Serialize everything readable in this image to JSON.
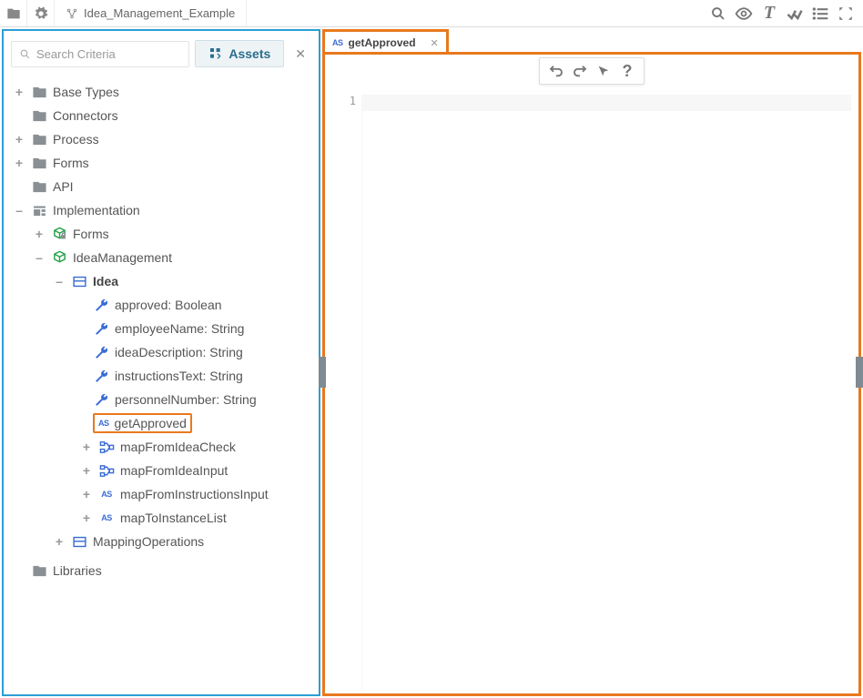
{
  "tabs": {
    "project": "Idea_Management_Example",
    "editor": "getApproved"
  },
  "search": {
    "placeholder": "Search Criteria",
    "assets": "Assets"
  },
  "gutter": {
    "line1": "1"
  },
  "tree": {
    "baseTypes": "Base Types",
    "connectors": "Connectors",
    "process": "Process",
    "forms": "Forms",
    "api": "API",
    "implementation": "Implementation",
    "implForms": "Forms",
    "ideaMgmt": "IdeaManagement",
    "idea": "Idea",
    "approved": "approved: Boolean",
    "employeeName": "employeeName: String",
    "ideaDescription": "ideaDescription: String",
    "instructionsText": "instructionsText: String",
    "personnelNumber": "personnelNumber: String",
    "getApproved": "getApproved",
    "mapFromIdeaCheck": "mapFromIdeaCheck",
    "mapFromIdeaInput": "mapFromIdeaInput",
    "mapFromInstructionsInput": "mapFromInstructionsInput",
    "mapToInstanceList": "mapToInstanceList",
    "mappingOperations": "MappingOperations",
    "libraries": "Libraries"
  }
}
